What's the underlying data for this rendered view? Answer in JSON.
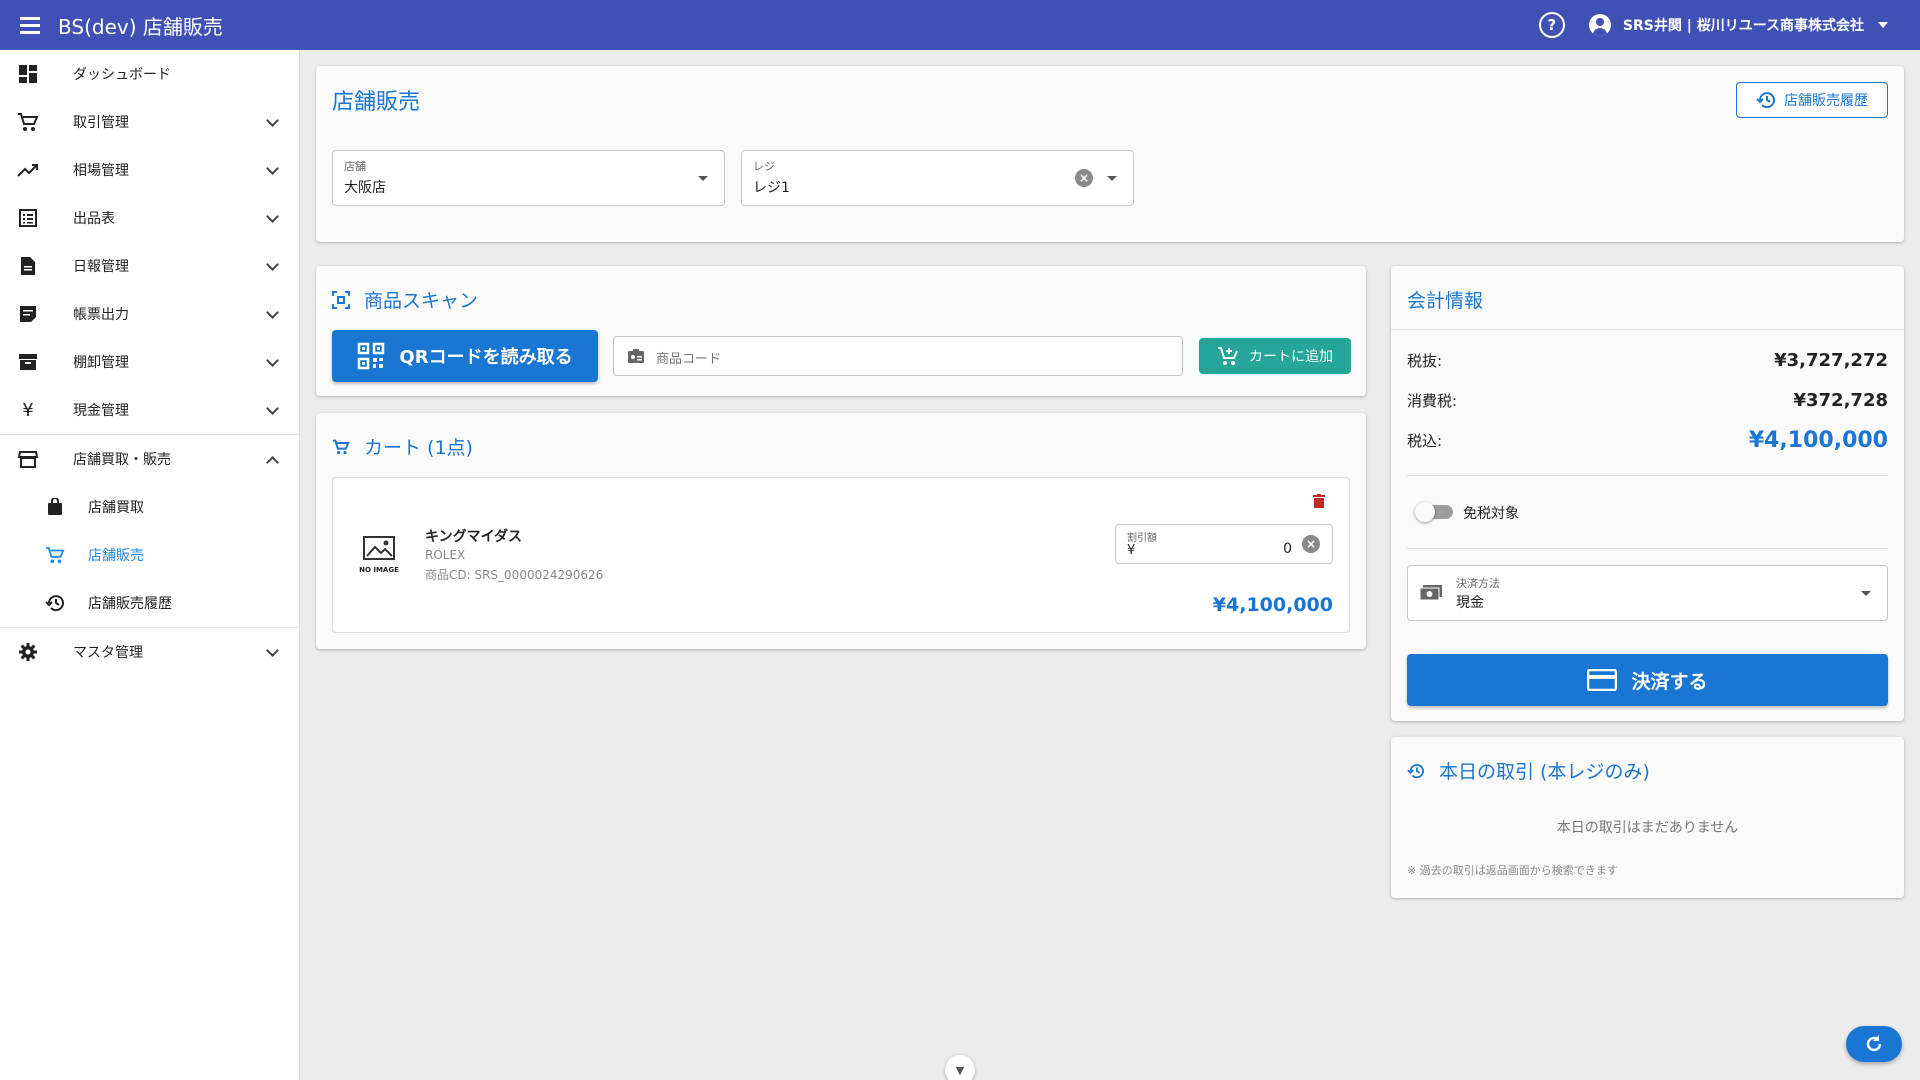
{
  "app": {
    "title": "BS(dev) 店舗販売",
    "user": "SRS井関 | 桜川リユース商事株式会社"
  },
  "icons": {
    "menu": "menu-icon",
    "help": "help-icon",
    "account": "account-circle-icon",
    "dashboard": "dashboard-icon",
    "cart": "cart-icon",
    "trend": "trending-up-icon",
    "list": "list-icon",
    "doc": "document-icon",
    "note": "note-icon",
    "archive": "archive-icon",
    "yen": "yen-icon",
    "store": "store-icon",
    "bag": "shopping-bag-icon",
    "history": "history-icon",
    "gear": "gear-icon"
  },
  "sidebar": {
    "items": [
      {
        "label": "ダッシュボード"
      },
      {
        "label": "取引管理"
      },
      {
        "label": "相場管理"
      },
      {
        "label": "出品表"
      },
      {
        "label": "日報管理"
      },
      {
        "label": "帳票出力"
      },
      {
        "label": "棚卸管理"
      },
      {
        "label": "現金管理"
      },
      {
        "label": "店舗買取・販売"
      },
      {
        "label": "マスタ管理"
      }
    ],
    "sub_items": [
      {
        "label": "店舗買取"
      },
      {
        "label": "店舗販売"
      },
      {
        "label": "店舗販売履歴"
      }
    ]
  },
  "header": {
    "title": "店舗販売",
    "history_button": "店舗販売履歴",
    "store": {
      "label": "店舗",
      "value": "大阪店"
    },
    "register": {
      "label": "レジ",
      "value": "レジ1"
    }
  },
  "scan": {
    "title": "商品スキャン",
    "qr_button": "QRコードを読み取る",
    "code_placeholder": "商品コード",
    "add_button": "カートに追加"
  },
  "cart": {
    "title": "カート (1点)",
    "items": [
      {
        "name": "キングマイダス",
        "brand": "ROLEX",
        "code": "商品CD: SRS_0000024290626",
        "no_image": "NO IMAGE",
        "discount_label": "割引額",
        "currency": "¥",
        "discount_value": "0",
        "price": "¥4,100,000"
      }
    ]
  },
  "accounting": {
    "title": "会計情報",
    "rows": [
      {
        "label": "税抜:",
        "value": "¥3,727,272"
      },
      {
        "label": "消費税:",
        "value": "¥372,728"
      },
      {
        "label": "税込:",
        "value": "¥4,100,000"
      }
    ],
    "tax_free_label": "免税対象",
    "tax_free": false,
    "payment": {
      "label": "決済方法",
      "value": "現金"
    },
    "pay_button": "決済する"
  },
  "today": {
    "title": "本日の取引 (本レジのみ)",
    "empty": "本日の取引はまだありません",
    "note": "※ 過去の取引は返品画面から検索できます"
  },
  "colors": {
    "primary_bar": "#3f51b5",
    "accent": "#1976d2",
    "teal": "#26a69a",
    "delete": "#c62828"
  }
}
